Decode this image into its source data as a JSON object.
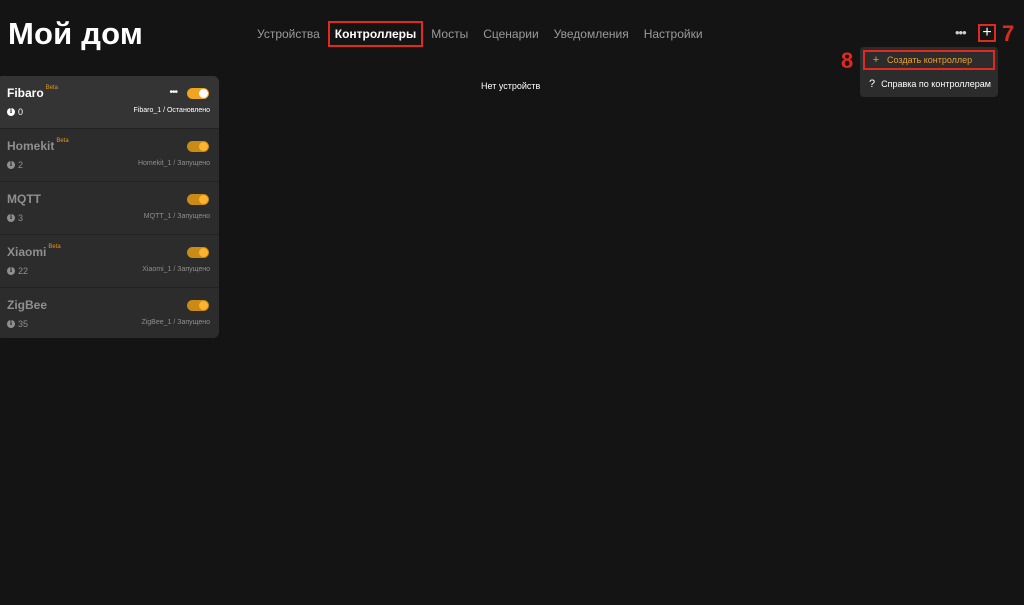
{
  "app": {
    "title": "Мой дом"
  },
  "nav": {
    "tabs": [
      {
        "label": "Устройства",
        "active": false
      },
      {
        "label": "Контроллеры",
        "active": true
      },
      {
        "label": "Мосты",
        "active": false
      },
      {
        "label": "Сценарии",
        "active": false
      },
      {
        "label": "Уведомления",
        "active": false
      },
      {
        "label": "Настройки",
        "active": false
      }
    ]
  },
  "toolbar": {
    "more_glyph": "•••",
    "add_glyph": "+"
  },
  "annotations": {
    "seven": "7",
    "eight": "8"
  },
  "dropdown": {
    "create_icon": "+",
    "create_label": "Создать контроллер",
    "help_icon": "?",
    "help_label": "Справка по контроллерам"
  },
  "main": {
    "empty_message": "Нет устройств"
  },
  "controllers": [
    {
      "name": "Fibaro",
      "beta": "Beta",
      "count": "0",
      "status": "Fibaro_1 / Остановлено",
      "more": "•••",
      "enabled": true
    },
    {
      "name": "Homekit",
      "beta": "Beta",
      "count": "2",
      "status": "Homekit_1 / Запущено",
      "enabled": true
    },
    {
      "name": "MQTT",
      "beta": "",
      "count": "3",
      "status": "MQTT_1 / Запущено",
      "enabled": true
    },
    {
      "name": "Xiaomi",
      "beta": "Beta",
      "count": "22",
      "status": "Xiaomi_1 / Запущено",
      "enabled": true
    },
    {
      "name": "ZigBee",
      "beta": "",
      "count": "35",
      "status": "ZigBee_1 / Запущено",
      "enabled": true
    }
  ],
  "colors": {
    "accent": "#f0a51f",
    "highlight": "#e02a1f",
    "background": "#141414"
  }
}
